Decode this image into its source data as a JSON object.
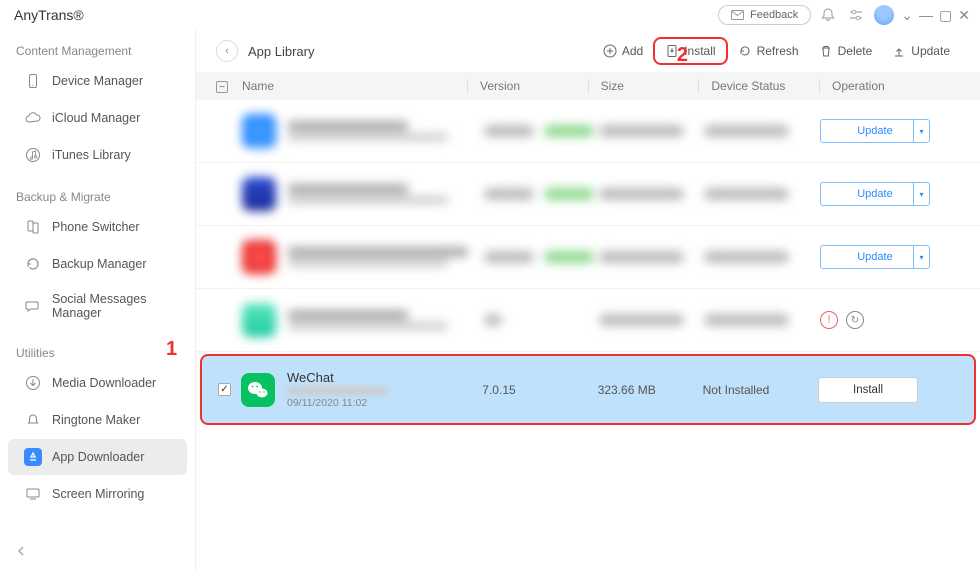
{
  "app": {
    "title": "AnyTrans®"
  },
  "header": {
    "feedback": "Feedback"
  },
  "sidebar": {
    "sections": [
      {
        "title": "Content Management",
        "items": [
          {
            "label": "Device Manager"
          },
          {
            "label": "iCloud Manager"
          },
          {
            "label": "iTunes Library"
          }
        ]
      },
      {
        "title": "Backup & Migrate",
        "items": [
          {
            "label": "Phone Switcher"
          },
          {
            "label": "Backup Manager"
          },
          {
            "label": "Social Messages Manager"
          }
        ]
      },
      {
        "title": "Utilities",
        "items": [
          {
            "label": "Media Downloader"
          },
          {
            "label": "Ringtone Maker"
          },
          {
            "label": "App Downloader"
          },
          {
            "label": "Screen Mirroring"
          }
        ]
      }
    ]
  },
  "toolbar": {
    "breadcrumb": "App Library",
    "add": "Add",
    "install": "Install",
    "refresh": "Refresh",
    "delete": "Delete",
    "update": "Update"
  },
  "table": {
    "headers": {
      "name": "Name",
      "version": "Version",
      "size": "Size",
      "status": "Device Status",
      "operation": "Operation"
    },
    "op_update": "Update",
    "selected_row": {
      "name": "WeChat",
      "date": "09/11/2020 11:02",
      "version": "7.0.15",
      "size": "323.66 MB",
      "status": "Not Installed",
      "action": "Install"
    }
  },
  "annotations": {
    "one": "1",
    "two": "2"
  }
}
